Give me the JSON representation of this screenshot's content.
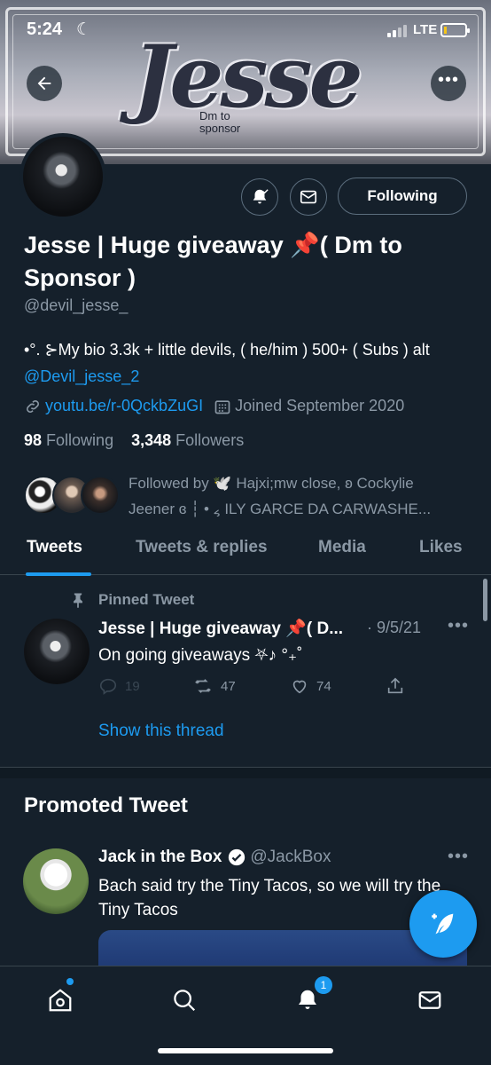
{
  "status_bar": {
    "time": "5:24",
    "network": "LTE"
  },
  "banner": {
    "logo_text": "Jesse",
    "sub_text_1": "Dm to",
    "sub_text_2": "sponsor"
  },
  "profile": {
    "name": "Jesse | Huge giveaway 📌( Dm to Sponsor )",
    "handle": "@devil_jesse_",
    "bio_text": "•°. ⊱My bio 3.3k + little devils, ( he/him ) 500+ ( Subs ) alt ",
    "bio_mention": "@Devil_jesse_2",
    "website": "youtu.be/r-0QckbZuGI",
    "joined": "Joined September 2020",
    "following_count": "98",
    "following_label": "Following",
    "followers_count": "3,348",
    "followers_label": "Followers",
    "followed_by_line1": "Followed by 🕊️ Hajxi;mw close, ʚ Cockylie",
    "followed_by_line2": "Jeener ɞ ┆ • ៹ ILY GARCE DA CARWASHE..."
  },
  "actions": {
    "following_button": "Following"
  },
  "tabs": [
    {
      "label": "Tweets",
      "active": true
    },
    {
      "label": "Tweets & replies",
      "active": false
    },
    {
      "label": "Media",
      "active": false
    },
    {
      "label": "Likes",
      "active": false
    }
  ],
  "pinned_tweet": {
    "label": "Pinned Tweet",
    "author": "Jesse | Huge giveaway 📌( D...",
    "date": "· 9/5/21",
    "text": "On going giveaways ⛧♪ °₊˚",
    "replies": "19",
    "retweets": "47",
    "likes": "74",
    "show_thread": "Show this thread"
  },
  "promoted": {
    "section_title": "Promoted Tweet",
    "author": "Jack in the Box",
    "handle": "@JackBox",
    "text": "Bach said try the Tiny Tacos, so we will try the Tiny Tacos"
  },
  "nav": {
    "notification_count": "1"
  },
  "colors": {
    "background": "#15202b",
    "accent": "#1d9bf0",
    "muted": "#8b98a5",
    "border": "#38444d"
  }
}
